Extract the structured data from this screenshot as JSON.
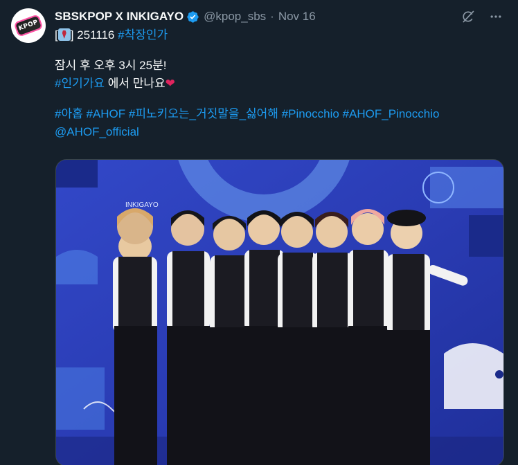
{
  "tweet": {
    "author_name": "SBSKPOP X INKIGAYO",
    "handle": "@kpop_sbs",
    "separator": "·",
    "date": "Nov 16",
    "avatar_text": "KPOP",
    "line1_open": "[",
    "line1_mid": "] 251116 ",
    "line1_hashtag": "#착장인가",
    "line2": "잠시 후 오후 3시 25분!",
    "line3_hashtag": "#인기가요",
    "line3_text": " 에서 만나요",
    "heart": "❤",
    "hashtags": [
      "#아홉",
      "#AHOF",
      "#피노키오는_거짓말을_싫어해",
      "#Pinocchio",
      "#AHOF_Pinocchio"
    ],
    "mention": "@AHOF_official",
    "media_backdrop_text": "INKIGAYO"
  },
  "colors": {
    "background": "#15202b",
    "text": "#f7f9f9",
    "muted": "#8b98a5",
    "link": "#1d9bf0",
    "verified": "#1d9bf0"
  },
  "icons": {
    "verified": "verified-badge-icon",
    "grok": "grok-icon",
    "more": "more-icon"
  }
}
